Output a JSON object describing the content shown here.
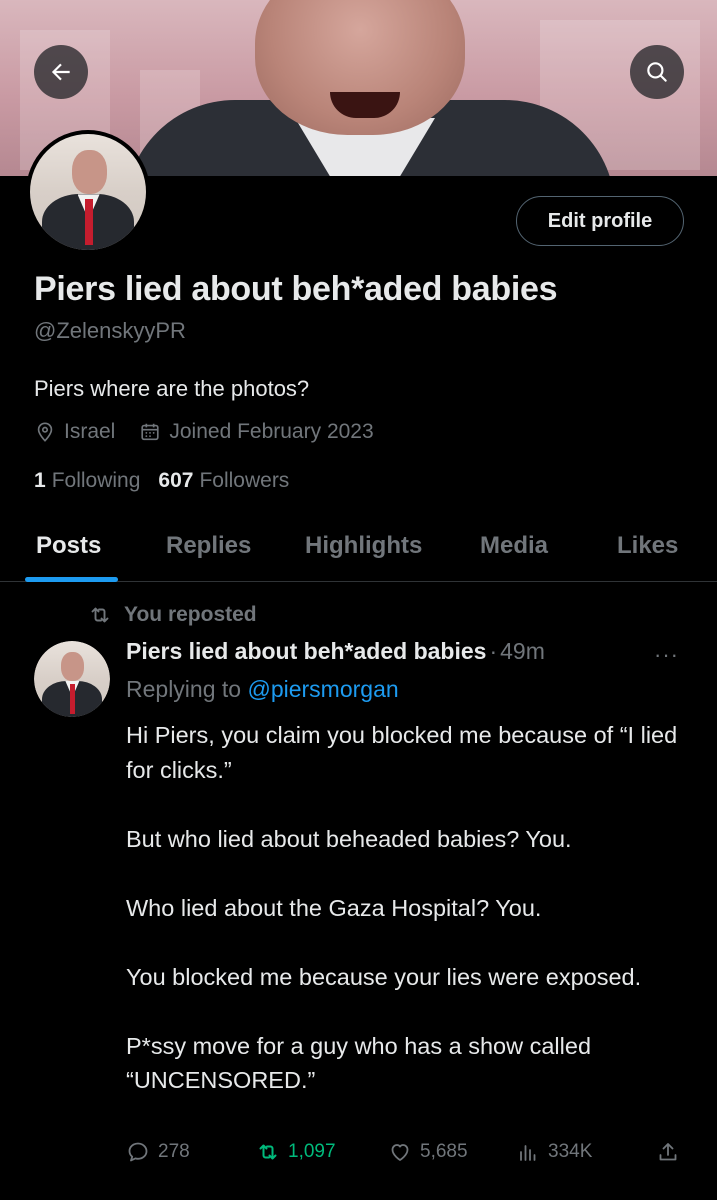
{
  "header": {
    "back_icon": "arrow-left-icon",
    "search_icon": "search-icon"
  },
  "profile": {
    "edit_label": "Edit profile",
    "name": "Piers lied about beh*aded babies",
    "handle": "@ZelenskyyPR",
    "bio": "Piers where are the photos?",
    "location": "Israel",
    "joined": "Joined February 2023",
    "following_count": "1",
    "following_label": "Following",
    "followers_count": "607",
    "followers_label": "Followers"
  },
  "tabs": [
    {
      "label": "Posts",
      "active": true
    },
    {
      "label": "Replies"
    },
    {
      "label": "Highlights"
    },
    {
      "label": "Media"
    },
    {
      "label": "Likes"
    }
  ],
  "post": {
    "repost_label": "You reposted",
    "author": "Piers lied about beh*aded babies",
    "separator": "·",
    "time": "49m",
    "more": "···",
    "replying_prefix": "Replying to",
    "replying_to": "@piersmorgan",
    "paragraphs": [
      "Hi Piers, you claim you blocked me because of “I lied for clicks.”",
      "But who lied about beheaded babies? You.",
      "Who lied about the Gaza Hospital? You.",
      "You blocked me because your lies were exposed.",
      "P*ssy move for a guy who has a show called “UNCENSORED.”"
    ],
    "replies": "278",
    "reposts": "1,097",
    "likes": "5,685",
    "views": "334K"
  },
  "colors": {
    "accent": "#1d9bf0",
    "muted": "#71767b",
    "repost_green": "#00ba7c",
    "background": "#000000"
  }
}
